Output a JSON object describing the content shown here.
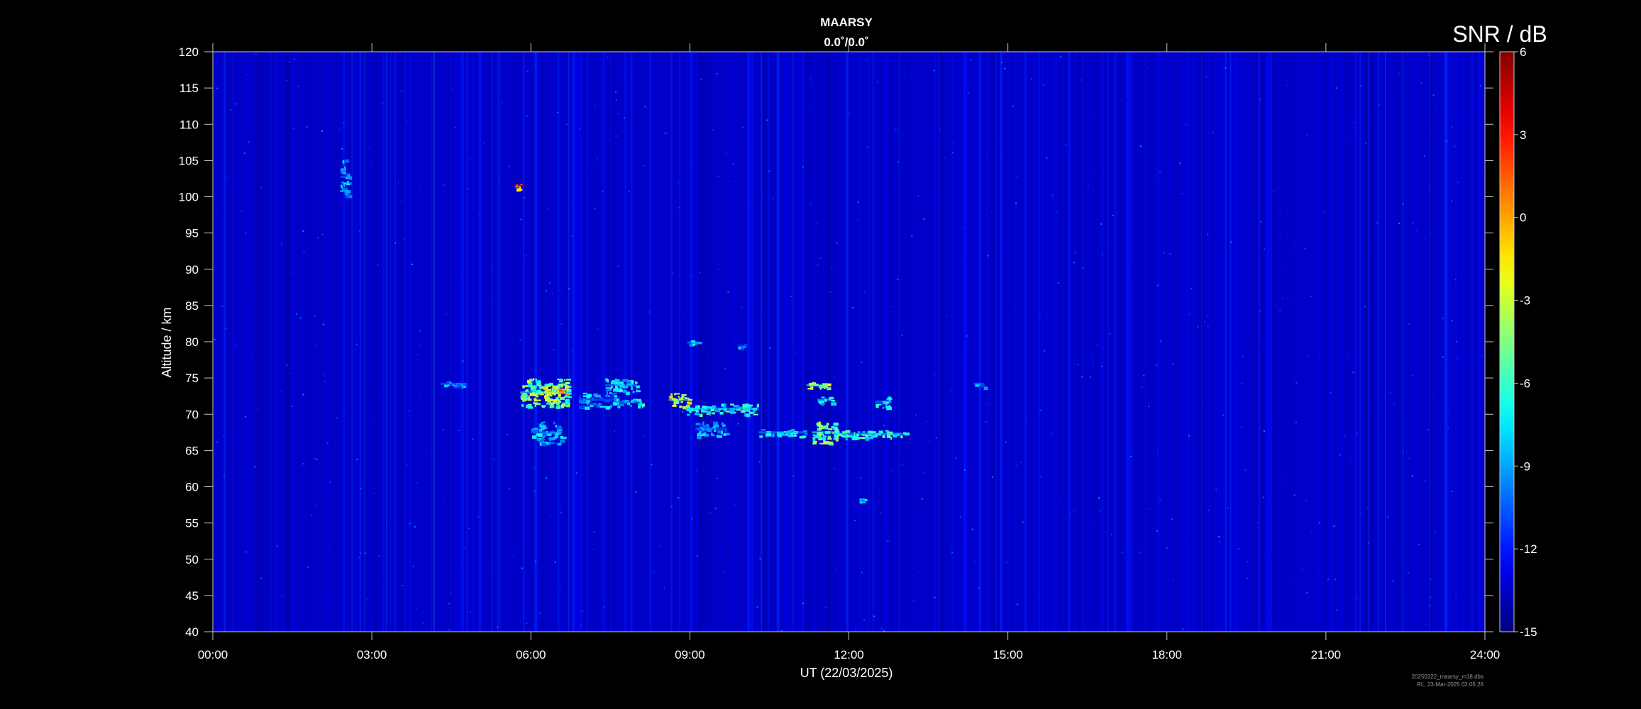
{
  "chart_data": {
    "type": "heatmap",
    "title": "MAARSY",
    "subtitle": "0.0˚/0.0˚",
    "xlabel": "UT (22/03/2025)",
    "ylabel": "Altitude / km",
    "x_unit": "hours UT",
    "xlim": [
      0,
      24
    ],
    "ylim": [
      40,
      120
    ],
    "x_ticks": [
      {
        "value": 0,
        "label": "00:00"
      },
      {
        "value": 3,
        "label": "03:00"
      },
      {
        "value": 6,
        "label": "06:00"
      },
      {
        "value": 9,
        "label": "09:00"
      },
      {
        "value": 12,
        "label": "12:00"
      },
      {
        "value": 15,
        "label": "15:00"
      },
      {
        "value": 18,
        "label": "18:00"
      },
      {
        "value": 21,
        "label": "21:00"
      },
      {
        "value": 24,
        "label": "24:00"
      }
    ],
    "y_ticks": [
      40,
      45,
      50,
      55,
      60,
      65,
      70,
      75,
      80,
      85,
      90,
      95,
      100,
      105,
      110,
      115,
      120
    ],
    "colorbar": {
      "title": "SNR / dB",
      "range": [
        -15,
        6
      ],
      "ticks": [
        6,
        3,
        0,
        -3,
        -6,
        -9,
        -12,
        -15
      ],
      "colormap": "jet"
    },
    "background_snr_db": -13.5,
    "features": [
      {
        "t_start": 2.4,
        "t_end": 2.55,
        "alt_min": 100,
        "alt_max": 105.5,
        "snr_db": -8
      },
      {
        "t_start": 5.7,
        "t_end": 5.8,
        "alt_min": 101,
        "alt_max": 101.8,
        "snr_db": 2
      },
      {
        "t_start": 4.3,
        "t_end": 4.75,
        "alt_min": 73.8,
        "alt_max": 74.6,
        "snr_db": -8
      },
      {
        "t_start": 5.8,
        "t_end": 6.7,
        "alt_min": 71,
        "alt_max": 75,
        "snr_db": -4
      },
      {
        "t_start": 6.2,
        "t_end": 6.5,
        "alt_min": 72,
        "alt_max": 74,
        "snr_db": -1
      },
      {
        "t_start": 6.5,
        "t_end": 6.65,
        "alt_min": 72.5,
        "alt_max": 73.5,
        "snr_db": 1
      },
      {
        "t_start": 6.0,
        "t_end": 6.6,
        "alt_min": 66,
        "alt_max": 69,
        "snr_db": -8
      },
      {
        "t_start": 6.9,
        "t_end": 7.6,
        "alt_min": 71,
        "alt_max": 73,
        "snr_db": -8
      },
      {
        "t_start": 7.4,
        "t_end": 8.0,
        "alt_min": 73,
        "alt_max": 75,
        "snr_db": -7
      },
      {
        "t_start": 7.6,
        "t_end": 8.1,
        "alt_min": 71.2,
        "alt_max": 72.2,
        "snr_db": -7
      },
      {
        "t_start": 8.6,
        "t_end": 9.0,
        "alt_min": 71,
        "alt_max": 73,
        "snr_db": -2
      },
      {
        "t_start": 8.9,
        "t_end": 10.3,
        "alt_min": 70,
        "alt_max": 71.5,
        "snr_db": -6
      },
      {
        "t_start": 9.1,
        "t_end": 9.7,
        "alt_min": 67,
        "alt_max": 69,
        "snr_db": -8
      },
      {
        "t_start": 8.95,
        "t_end": 9.15,
        "alt_min": 79.6,
        "alt_max": 80.2,
        "snr_db": -7
      },
      {
        "t_start": 9.9,
        "t_end": 10.1,
        "alt_min": 79.2,
        "alt_max": 79.8,
        "snr_db": -9
      },
      {
        "t_start": 10.3,
        "t_end": 11.2,
        "alt_min": 67,
        "alt_max": 68,
        "snr_db": -7
      },
      {
        "t_start": 11.2,
        "t_end": 11.6,
        "alt_min": 73.5,
        "alt_max": 74.5,
        "snr_db": -3
      },
      {
        "t_start": 11.4,
        "t_end": 11.7,
        "alt_min": 71.5,
        "alt_max": 72.5,
        "snr_db": -6
      },
      {
        "t_start": 11.3,
        "t_end": 11.75,
        "alt_min": 66,
        "alt_max": 69,
        "snr_db": -4
      },
      {
        "t_start": 11.7,
        "t_end": 13.05,
        "alt_min": 66.8,
        "alt_max": 67.8,
        "snr_db": -6
      },
      {
        "t_start": 12.5,
        "t_end": 12.8,
        "alt_min": 71,
        "alt_max": 72.5,
        "snr_db": -7
      },
      {
        "t_start": 14.35,
        "t_end": 14.55,
        "alt_min": 73.8,
        "alt_max": 74.6,
        "snr_db": -8
      },
      {
        "t_start": 12.2,
        "t_end": 12.3,
        "alt_min": 57.8,
        "alt_max": 58.4,
        "snr_db": -8
      }
    ],
    "colors": {
      "background": "#000000",
      "axis": "#c8c8c8"
    },
    "footer": [
      "20250322_maarsy_m18.dbs",
      "RL, 23-Mar-2025 02:05:26"
    ]
  }
}
